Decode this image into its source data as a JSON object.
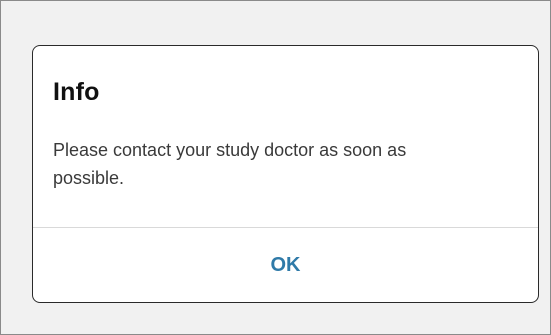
{
  "dialog": {
    "title": "Info",
    "message": "Please contact your study doctor as soon as possible.",
    "ok_label": "OK"
  },
  "colors": {
    "background": "#f1f1f1",
    "dialog_background": "#ffffff",
    "accent": "#2f7aa8",
    "title_text": "#111111",
    "body_text": "#3a3a3a"
  }
}
